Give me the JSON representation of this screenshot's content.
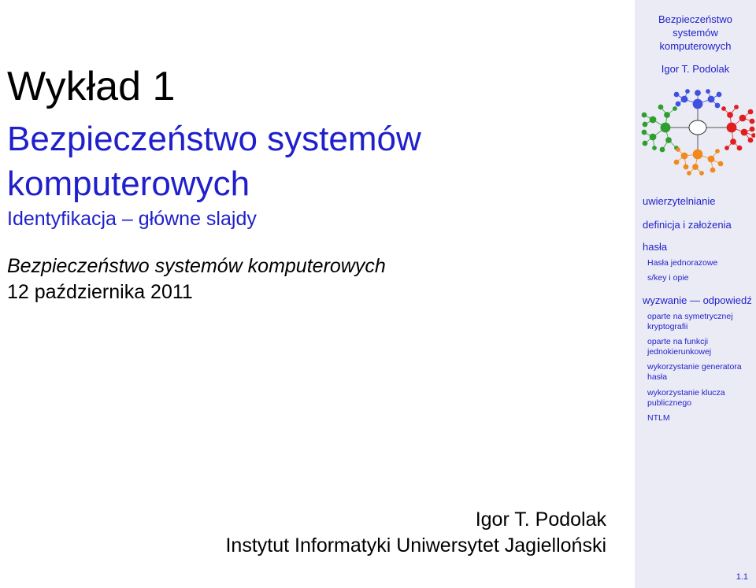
{
  "slide": {
    "lecture": "Wykład 1",
    "course_line1": "Bezpieczeństwo systemów",
    "course_line2": "komputerowych",
    "subtitle": "Identyfikacja – główne slajdy",
    "course_name": "Bezpieczeństwo systemów komputerowych",
    "date": "12 października 2011",
    "author": "Igor T. Podolak",
    "institution": "Instytut Informatyki Uniwersytet Jagielloński"
  },
  "sidebar": {
    "course_title_lines": [
      "Bezpieczeństwo",
      "systemów",
      "komputerowych"
    ],
    "author": "Igor T. Podolak",
    "sections": [
      {
        "label": "uwierzytelnianie"
      },
      {
        "label": "definicja i założenia"
      },
      {
        "label": "hasła",
        "subsections": [
          "Hasła jednorazowe",
          "s/key i opie"
        ]
      },
      {
        "label": "wyzwanie — odpowiedź",
        "subsections": [
          "oparte na symetrycznej kryptografii",
          "oparte na funkcji jednokierunkowej",
          "wykorzystanie generatora hasła",
          "wykorzystanie klucza publicznego",
          "NTLM"
        ]
      }
    ],
    "page_number": "1.1"
  },
  "colors": {
    "title_blue": "#1f1fcc",
    "sidebar_bg": "#ebebf5",
    "mindmap_green": "#2e9e2e",
    "mindmap_blue": "#4050e0",
    "mindmap_red": "#e01e1e",
    "mindmap_orange": "#f08a1e"
  }
}
